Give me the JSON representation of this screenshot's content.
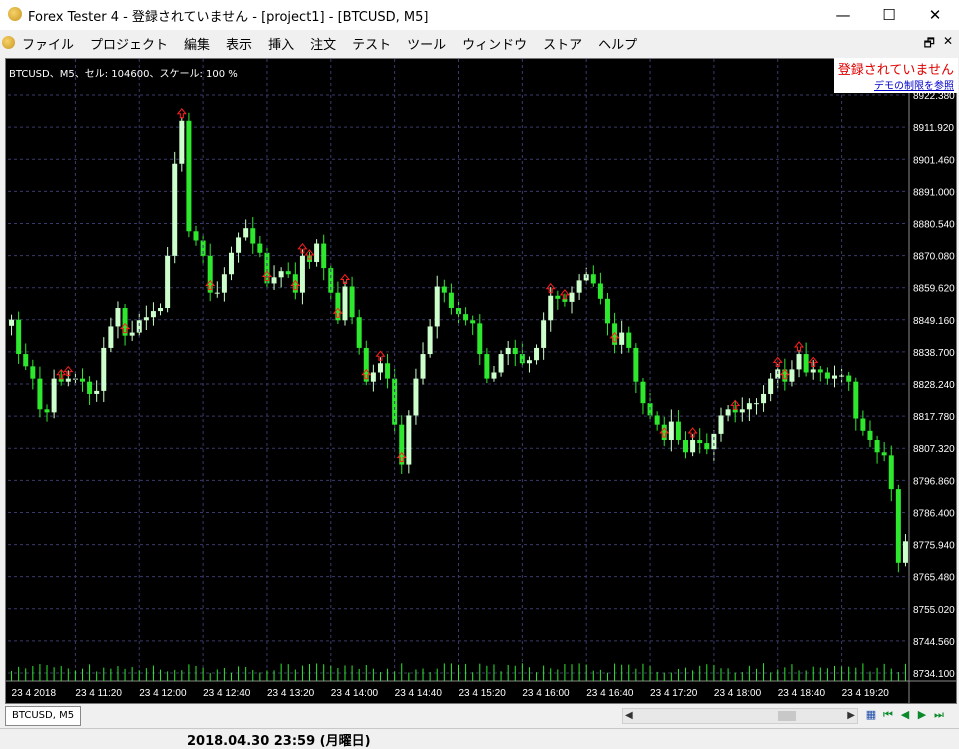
{
  "window": {
    "title": "Forex Tester 4 - 登録されていません - [project1] - [BTCUSD, M5]",
    "minimize": "—",
    "maximize": "☐",
    "close": "✕"
  },
  "menu": {
    "items": [
      "ファイル",
      "プロジェクト",
      "編集",
      "表示",
      "挿入",
      "注文",
      "テスト",
      "ツール",
      "ウィンドウ",
      "ストア",
      "ヘルプ"
    ],
    "restore": "🗗",
    "close": "✕"
  },
  "chart": {
    "info": "BTCUSD、M5、セル: 104600、スケール: 100 %",
    "unregistered": "登録されていません",
    "demo_link": "デモの制限を参照",
    "colors": {
      "bull": "#ccffcc",
      "bear": "#2ee82e",
      "grid": "#3a3a6a",
      "volume": "#2ee82e",
      "signal": "#ff2020"
    }
  },
  "chart_data": {
    "type": "candlestick",
    "symbol": "BTCUSD",
    "timeframe": "M5",
    "ylim": [
      8734.1,
      8925.0
    ],
    "y_ticks": [
      "8922.380",
      "8911.920",
      "8901.460",
      "8891.000",
      "8880.540",
      "8870.080",
      "8859.620",
      "8849.160",
      "8838.700",
      "8828.240",
      "8817.780",
      "8807.320",
      "8796.860",
      "8786.400",
      "8775.940",
      "8765.480",
      "8755.020",
      "8744.560",
      "8734.100"
    ],
    "x_ticks": [
      "23 4 2018",
      "23 4 11:20",
      "23 4 12:00",
      "23 4 12:40",
      "23 4 13:20",
      "23 4 14:00",
      "23 4 14:40",
      "23 4 15:20",
      "23 4 16:00",
      "23 4 16:40",
      "23 4 17:20",
      "23 4 18:00",
      "23 4 18:40",
      "23 4 19:20"
    ],
    "close": [
      8849.2,
      8838.0,
      8834.0,
      8830.0,
      8820.0,
      8819.0,
      8830.0,
      8829.0,
      8830.0,
      8830.0,
      8829.0,
      8825.0,
      8826.0,
      8840.0,
      8847.0,
      8853.0,
      8844.0,
      8845.0,
      8849.0,
      8850.0,
      8852.0,
      8853.0,
      8870.0,
      8900.0,
      8914.0,
      8878.0,
      8875.0,
      8870.0,
      8858.0,
      8858.0,
      8864.0,
      8871.0,
      8876.0,
      8879.0,
      8874.0,
      8871.0,
      8861.0,
      8863.0,
      8865.0,
      8864.0,
      8858.0,
      8870.0,
      8868.0,
      8874.0,
      8866.0,
      8858.0,
      8849.0,
      8860.0,
      8850.0,
      8840.0,
      8829.0,
      8832.0,
      8835.0,
      8830.0,
      8815.0,
      8802.0,
      8818.0,
      8830.0,
      8838.0,
      8847.0,
      8860.0,
      8858.0,
      8853.0,
      8851.0,
      8849.0,
      8848.0,
      8838.0,
      8830.0,
      8832.0,
      8838.0,
      8840.0,
      8838.0,
      8835.0,
      8836.0,
      8840.0,
      8849.0,
      8857.0,
      8856.0,
      8855.0,
      8858.0,
      8862.0,
      8864.0,
      8861.0,
      8856.0,
      8848.0,
      8841.0,
      8845.0,
      8840.0,
      8829.0,
      8822.0,
      8818.0,
      8815.0,
      8810.0,
      8816.0,
      8810.0,
      8806.0,
      8810.0,
      8809.0,
      8807.0,
      8812.0,
      8818.0,
      8820.0,
      8819.0,
      8820.0,
      8822.0,
      8822.0,
      8825.0,
      8830.0,
      8833.0,
      8829.0,
      8833.0,
      8838.0,
      8832.0,
      8833.0,
      8832.0,
      8830.0,
      8831.0,
      8831.0,
      8829.0,
      8817.0,
      8813.0,
      8810.0,
      8806.0,
      8805.0,
      8794.0,
      8770.0,
      8777.0
    ]
  },
  "tabs": [
    {
      "label": "BTCUSD, M5"
    }
  ],
  "nav": {
    "scroll_left": "◀",
    "scroll_right": "▶",
    "grid_icon": "▦",
    "first": "⏮",
    "prev": "◀",
    "play": "▶",
    "last": "⏭"
  },
  "status": {
    "datetime": "2018.04.30 23:59 (月曜日)"
  }
}
